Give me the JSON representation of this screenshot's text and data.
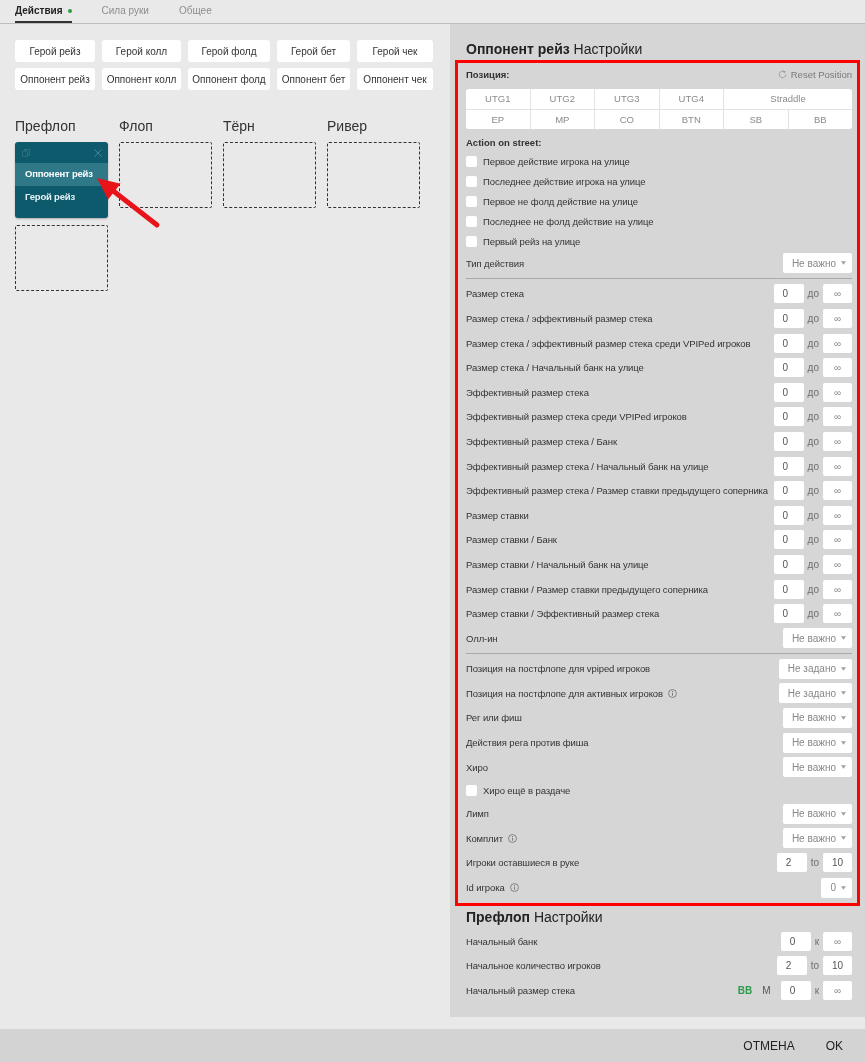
{
  "tabs": [
    {
      "label": "Действия",
      "selected": true,
      "dot": true
    },
    {
      "label": "Сила руки",
      "selected": false,
      "dot": false
    },
    {
      "label": "Общее",
      "selected": false,
      "dot": false
    }
  ],
  "action_buttons": [
    "Герой рейз",
    "Герой колл",
    "Герой фолд",
    "Герой бет",
    "Герой чек",
    "Оппонент рейз",
    "Оппонент колл",
    "Оппонент фолд",
    "Оппонент бет",
    "Оппонент чек"
  ],
  "streets": [
    {
      "name": "Префлоп",
      "actions": [
        {
          "label": "Оппонент рейз",
          "selected": true
        },
        {
          "label": "Герой рейз",
          "selected": false
        }
      ]
    },
    {
      "name": "Флоп"
    },
    {
      "name": "Тёрн"
    },
    {
      "name": "Ривер"
    }
  ],
  "settings": {
    "title": "**Оппонент рейз** Настройки",
    "position": {
      "label": "Позиция:",
      "reset": "Reset Position",
      "rows": [
        [
          {
            "label": "UTG1",
            "selected": false
          },
          {
            "label": "UTG2",
            "selected": false
          },
          {
            "label": "UTG3",
            "selected": false
          },
          {
            "label": "UTG4",
            "selected": false
          },
          {
            "label": "Straddle",
            "selected": false
          }
        ],
        [
          {
            "label": "EP",
            "selected": false
          },
          {
            "label": "MP",
            "selected": false
          },
          {
            "label": "CO",
            "selected": false
          },
          {
            "label": "BTN",
            "selected": false
          },
          {
            "label": "SB",
            "selected": false
          },
          {
            "label": "BB",
            "selected": false
          }
        ]
      ]
    },
    "street_actions": {
      "label": "Action on street:",
      "options": [
        {
          "label": "Первое действие игрока на улице",
          "checked": false
        },
        {
          "label": "Последнее действие игрока на улице",
          "checked": false
        },
        {
          "label": "Первое не фолд действие на улице",
          "checked": false
        },
        {
          "label": "Последнее не фолд действие на улице",
          "checked": false
        },
        {
          "label": "Первый рейз на улице",
          "checked": false
        }
      ]
    },
    "groups": [
      [
        {
          "kind": "select",
          "label": "Тип действия",
          "value": "Не важно"
        }
      ],
      [
        {
          "kind": "range",
          "label": "Размер стека",
          "from": "0",
          "separator": "до",
          "to_placeholder": "∞"
        },
        {
          "kind": "range",
          "label": "Размер стека / эффективный размер стека",
          "from": "0",
          "separator": "до",
          "to_placeholder": "∞"
        },
        {
          "kind": "range",
          "label": "Размер стека / эффективный размер стека среди VPIPed игроков",
          "from": "0",
          "separator": "до",
          "to_placeholder": "∞"
        },
        {
          "kind": "range",
          "label": "Размер стека / Начальный банк на улице",
          "from": "0",
          "separator": "до",
          "to_placeholder": "∞"
        },
        {
          "kind": "range",
          "label": "Эффективный размер стека",
          "from": "0",
          "separator": "до",
          "to_placeholder": "∞"
        },
        {
          "kind": "range",
          "label": "Эффективный размер стека среди VPIPed игроков",
          "from": "0",
          "separator": "до",
          "to_placeholder": "∞"
        },
        {
          "kind": "range",
          "label": "Эффективный размер стека / Банк",
          "from": "0",
          "separator": "до",
          "to_placeholder": "∞"
        },
        {
          "kind": "range",
          "label": "Эффективный размер стека / Начальный банк на улице",
          "from": "0",
          "separator": "до",
          "to_placeholder": "∞"
        },
        {
          "kind": "range",
          "label": "Эффективный размер стека / Размер ставки предыдущего соперника",
          "from": "0",
          "separator": "до",
          "to_placeholder": "∞"
        },
        {
          "kind": "range",
          "label": "Размер ставки",
          "from": "0",
          "separator": "до",
          "to_placeholder": "∞"
        },
        {
          "kind": "range",
          "label": "Размер ставки / Банк",
          "from": "0",
          "separator": "до",
          "to_placeholder": "∞"
        },
        {
          "kind": "range",
          "label": "Размер ставки / Начальный банк на улице",
          "from": "0",
          "separator": "до",
          "to_placeholder": "∞"
        },
        {
          "kind": "range",
          "label": "Размер ставки / Размер ставки предыдущего соперника",
          "from": "0",
          "separator": "до",
          "to_placeholder": "∞"
        },
        {
          "kind": "range",
          "label": "Размер ставки / Эффективный размер стека",
          "from": "0",
          "separator": "до",
          "to_placeholder": "∞"
        },
        {
          "kind": "select",
          "label": "Олл-ин",
          "value": "Не важно"
        }
      ],
      [
        {
          "kind": "select",
          "label": "Позиция на постфлопе для vpiped игроков",
          "value": "Не задано"
        },
        {
          "kind": "select",
          "label": "Позиция на постфлопе для активных игроков",
          "value": "Не задано",
          "info": true
        },
        {
          "kind": "select",
          "label": "Рег или фиш",
          "value": "Не важно"
        },
        {
          "kind": "select",
          "label": "Действия рега против фиша",
          "value": "Не важно"
        },
        {
          "kind": "select",
          "label": "Хиро",
          "value": "Не важно"
        },
        {
          "kind": "checkbox",
          "label": "Хиро ещё в раздаче",
          "checked": false
        },
        {
          "kind": "select",
          "label": "Лимп",
          "value": "Не важно"
        },
        {
          "kind": "select",
          "label": "Комплит",
          "value": "Не важно",
          "info": true
        },
        {
          "kind": "range",
          "label": "Игроки оставшиеся в руке",
          "from": "2",
          "separator": "to",
          "to": "10"
        },
        {
          "kind": "select",
          "label": "Id игрока",
          "value": "0",
          "info": true
        }
      ]
    ]
  },
  "preflop_settings": {
    "title": "**Префлоп** Настройки",
    "rows": [
      {
        "kind": "range",
        "label": "Начальный банк",
        "from": "0",
        "separator": "к",
        "to_placeholder": "∞"
      },
      {
        "kind": "range",
        "label": "Начальное количество игроков",
        "from": "2",
        "separator": "to",
        "to": "10"
      },
      {
        "kind": "range",
        "label": "Начальный размер стека",
        "units": [
          {
            "label": "BB",
            "selected": true
          },
          {
            "label": "M",
            "selected": false
          }
        ],
        "from": "0",
        "separator": "к",
        "to_placeholder": "∞"
      }
    ]
  },
  "footer": {
    "buttons": [
      "ОТМЕНА",
      "OK"
    ]
  }
}
